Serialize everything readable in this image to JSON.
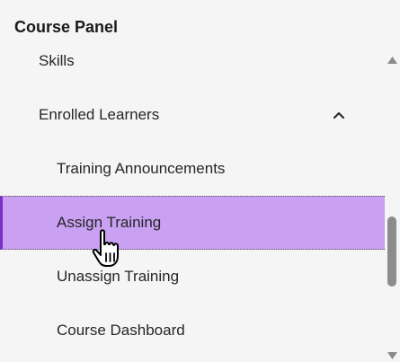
{
  "panel": {
    "title": "Course Panel"
  },
  "nav": {
    "items": [
      {
        "label": "Skills"
      },
      {
        "label": "Enrolled Learners",
        "expanded": true,
        "icon": "chevron-up-icon"
      },
      {
        "label": "Training Announcements"
      },
      {
        "label": "Assign Training",
        "selected": true
      },
      {
        "label": "Unassign Training"
      },
      {
        "label": "Course Dashboard"
      }
    ]
  },
  "colors": {
    "background": "#f5f5f5",
    "selected_background": "#c9a0f2",
    "selected_border": "#7b2fc9",
    "scroll_thumb": "#8c8c8c"
  },
  "icons": {
    "cursor": "hand-pointer-icon",
    "scroll_up": "scroll-up-arrow-icon",
    "scroll_down": "scroll-down-arrow-icon"
  }
}
